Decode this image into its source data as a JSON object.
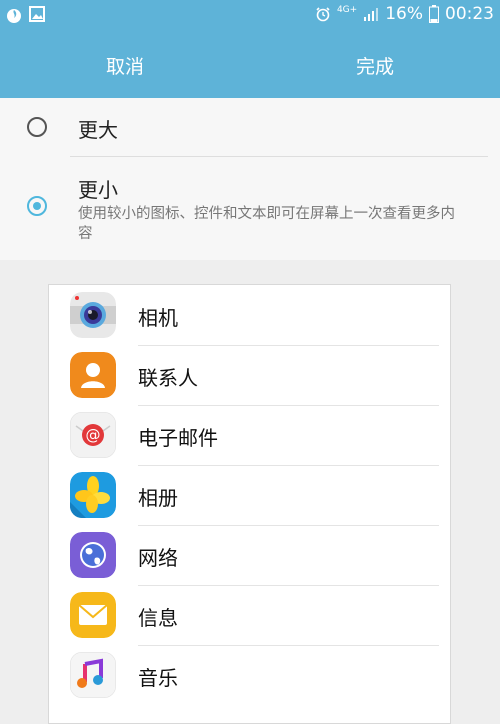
{
  "status_bar": {
    "network": "4G+",
    "battery_percent": "16%",
    "time": "00:23",
    "icons": [
      "fire-icon",
      "image-icon",
      "alarm-icon",
      "signal-icon",
      "battery-icon"
    ]
  },
  "action_bar": {
    "cancel_label": "取消",
    "done_label": "完成"
  },
  "options": [
    {
      "title": "更大",
      "selected": false
    },
    {
      "title": "更小",
      "selected": true,
      "description": "使用较小的图标、控件和文本即可在屏幕上一次查看更多内容"
    }
  ],
  "preview": {
    "apps": [
      {
        "label": "相机",
        "icon": "camera-icon"
      },
      {
        "label": "联系人",
        "icon": "contacts-icon"
      },
      {
        "label": "电子邮件",
        "icon": "email-icon"
      },
      {
        "label": "相册",
        "icon": "gallery-icon"
      },
      {
        "label": "网络",
        "icon": "internet-icon"
      },
      {
        "label": "信息",
        "icon": "messages-icon"
      },
      {
        "label": "音乐",
        "icon": "music-icon"
      }
    ]
  },
  "colors": {
    "accent": "#5eb3d8",
    "radio_checked": "#4fb7dd",
    "background": "#eeeeee"
  }
}
